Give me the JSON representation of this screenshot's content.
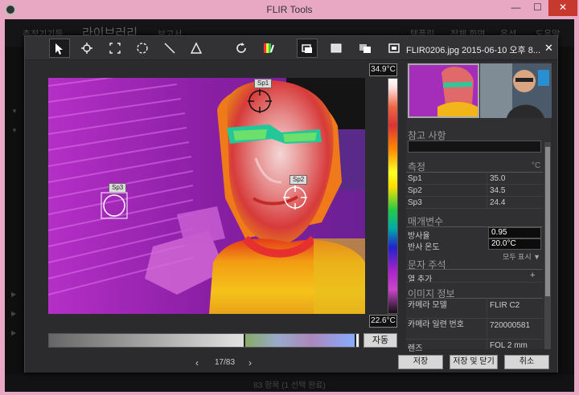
{
  "window": {
    "title": "FLIR Tools",
    "controls": {
      "minimize": "—",
      "maximize": "☐",
      "close": "✕"
    }
  },
  "background_app": {
    "menu": [
      "측정기기들",
      "라이브러리",
      "보고서",
      "템플릿",
      "전체 화면",
      "옵션",
      "도움말"
    ],
    "status": "83 항목 (1 선택 완료)"
  },
  "toolbar": {
    "tools": [
      "select-icon",
      "spot-icon",
      "box-icon",
      "circle-icon",
      "line-icon",
      "delta-icon",
      "rotate-icon",
      "palette-icon",
      "image-mode-1-icon",
      "image-mode-2-icon",
      "image-mode-3-icon",
      "image-mode-4-icon"
    ],
    "filename": "FLIR0206.jpg   2015-06-10 오후 8...",
    "close": "✕"
  },
  "image": {
    "temp_max": "34.9°C",
    "temp_min": "22.6°C",
    "spots": [
      {
        "label": "Sp1"
      },
      {
        "label": "Sp2"
      },
      {
        "label": "Sp3"
      }
    ],
    "auto_label": "자동"
  },
  "panel": {
    "notes_title": "참고 사항",
    "measure_title": "측정",
    "unit": "°C",
    "measurements": [
      {
        "name": "Sp1",
        "value": "35.0"
      },
      {
        "name": "Sp2",
        "value": "34.5"
      },
      {
        "name": "Sp3",
        "value": "24.4"
      }
    ],
    "params_title": "매개변수",
    "params": [
      {
        "name": "방사율",
        "value": "0.95"
      },
      {
        "name": "반사 온도",
        "value": "20.0°C"
      }
    ],
    "show_all": "모두 표시 ▼",
    "text_annot_title": "문자 주석",
    "add_column": "열 추가",
    "add_plus": "+",
    "image_info_title": "이미지 정보",
    "info": [
      {
        "name": "카메라 모델",
        "value": "FLIR C2"
      },
      {
        "name": "카메라 일련 번호",
        "value": "720000581"
      },
      {
        "name": "렌즈",
        "value": "FOL 2 mm"
      }
    ]
  },
  "footer": {
    "prev": "‹",
    "page": "17/83",
    "next": "›",
    "save": "저장",
    "save_close": "저장 및 닫기",
    "cancel": "취소"
  }
}
